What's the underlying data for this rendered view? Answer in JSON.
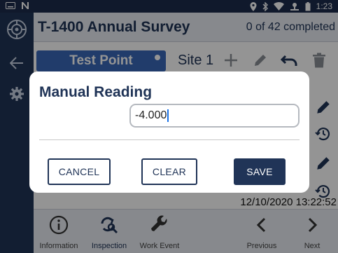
{
  "status_bar": {
    "time": "1:23"
  },
  "header": {
    "title": "T-1400 Annual Survey",
    "progress": "0 of 42 completed"
  },
  "subbar": {
    "test_point_label": "Test Point",
    "site_label": "Site 1"
  },
  "content": {
    "timestamp": "12/10/2020 13:22:52"
  },
  "bottom_nav": [
    {
      "label": "Information",
      "icon": "info-icon"
    },
    {
      "label": "Inspection",
      "icon": "inspection-icon"
    },
    {
      "label": "Work Event",
      "icon": "wrench-icon"
    },
    {
      "label": "Previous",
      "icon": "chevron-left-icon"
    },
    {
      "label": "Next",
      "icon": "chevron-right-icon"
    }
  ],
  "dialog": {
    "title": "Manual Reading",
    "value": "-4.000",
    "cancel_label": "CANCEL",
    "clear_label": "CLEAR",
    "save_label": "SAVE"
  },
  "colors": {
    "primary": "#203457",
    "accent": "#3a68b8",
    "header_bg": "#e9edf3"
  }
}
